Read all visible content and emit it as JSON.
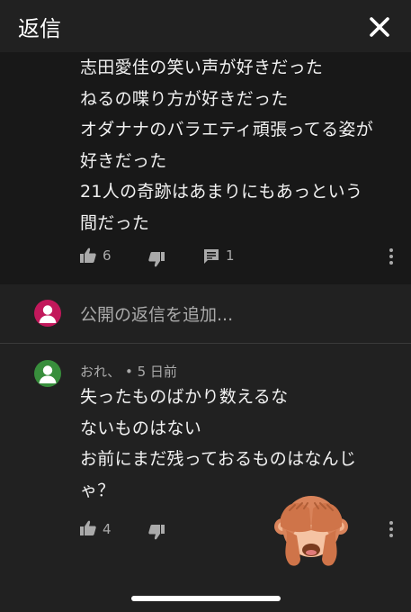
{
  "header": {
    "title": "返信"
  },
  "parent_comment": {
    "lines": [
      "志田愛佳の笑い声が好きだった",
      "ねるの喋り方が好きだった",
      "オダナナのバラエティ頑張ってる姿が",
      "好きだった",
      "21人の奇跡はあまりにもあっという",
      "間だった"
    ],
    "likes": "6",
    "replies": "1"
  },
  "add_reply": {
    "placeholder": "公開の返信を追加..."
  },
  "reply": {
    "author": "おれ、",
    "time": "5 日前",
    "lines": [
      "失ったものばかり数えるな",
      "ないものはない",
      "お前にまだ残っておるものはなんじ",
      "ゃ？"
    ],
    "likes": "4"
  },
  "colors": {
    "background": "#212121",
    "parent_background": "#181818",
    "text": "#f1f1f1",
    "secondary_text": "#aaaaaa",
    "avatar_pink": "#c2185b",
    "avatar_green": "#388e3c"
  },
  "icons": {
    "close": "close-icon",
    "like": "thumbs-up-icon",
    "dislike": "thumbs-down-icon",
    "reply": "comment-icon",
    "more": "more-vert-icon",
    "sticker": "see-no-evil-monkey-emoji"
  }
}
